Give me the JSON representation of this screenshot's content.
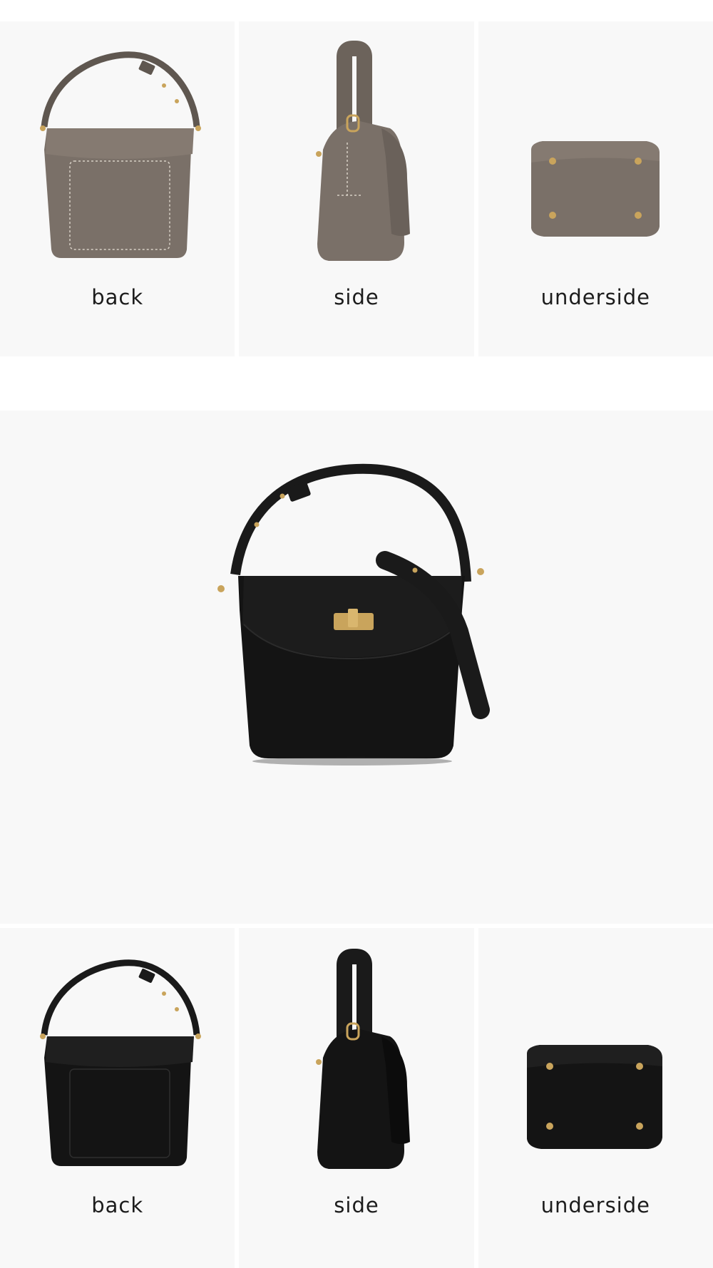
{
  "colors": {
    "taupe_bag": "#7a7068",
    "black_bag": "#141414",
    "tile_background": "#f8f8f8",
    "hardware_gold": "#c9a45c"
  },
  "top_row": {
    "items": [
      {
        "label": "back",
        "color": "taupe"
      },
      {
        "label": "side",
        "color": "taupe"
      },
      {
        "label": "underside",
        "color": "taupe"
      }
    ]
  },
  "hero": {
    "color": "black",
    "view": "front-with-strap"
  },
  "bottom_row": {
    "items": [
      {
        "label": "back",
        "color": "black"
      },
      {
        "label": "side",
        "color": "black"
      },
      {
        "label": "underside",
        "color": "black"
      }
    ]
  }
}
